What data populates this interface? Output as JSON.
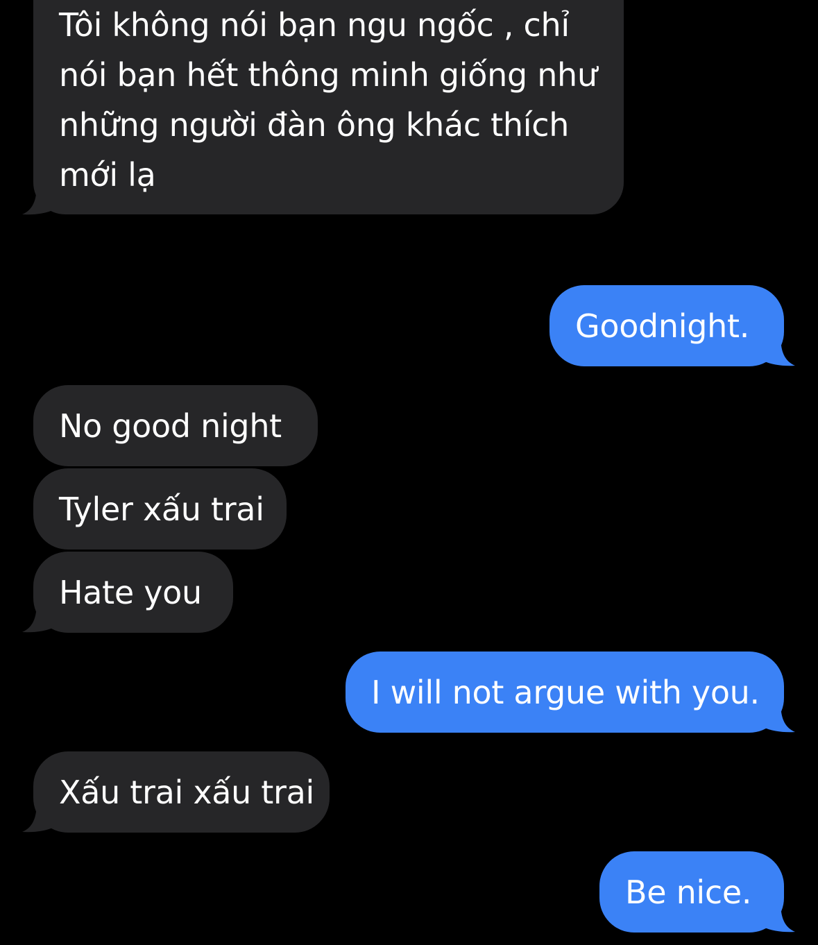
{
  "conversation": {
    "colors": {
      "background": "#000000",
      "incoming_bubble": "#262628",
      "outgoing_bubble": "#3b82f6",
      "text": "#ffffff"
    },
    "messages": [
      {
        "direction": "incoming",
        "text": "Tôi không nói bạn ngu ngốc , chỉ nói bạn hết thông minh giống như những người đàn ông khác thích mới lạ"
      },
      {
        "direction": "outgoing",
        "text": "Goodnight."
      },
      {
        "direction": "incoming",
        "text": "No good night"
      },
      {
        "direction": "incoming",
        "text": "Tyler xấu trai"
      },
      {
        "direction": "incoming",
        "text": "Hate you"
      },
      {
        "direction": "outgoing",
        "text": "I will not argue with you."
      },
      {
        "direction": "incoming",
        "text": "Xấu trai xấu trai"
      },
      {
        "direction": "outgoing",
        "text": "Be nice."
      }
    ]
  }
}
